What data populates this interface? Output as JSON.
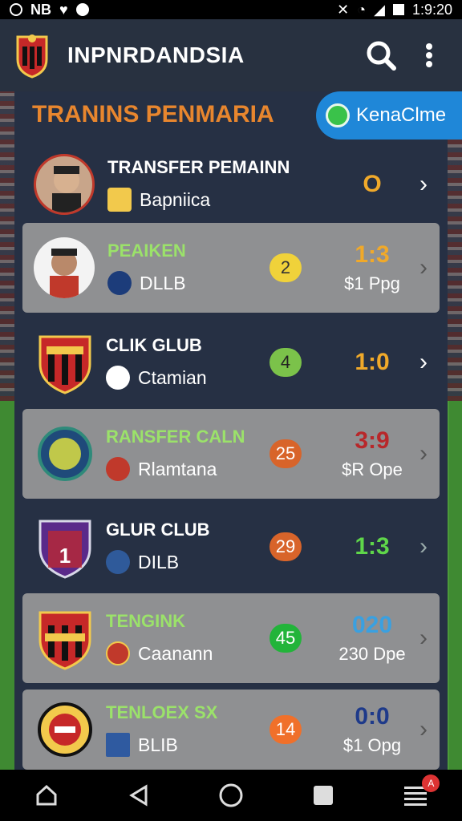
{
  "status": {
    "time": "1:9:20",
    "left_text": "NB"
  },
  "app": {
    "title": "INPNRDANDSIA"
  },
  "section": {
    "title": "TRANINS PENMARIA",
    "pill_label": "KenaClme"
  },
  "rows": [
    {
      "name": "TRANSFER PEMAINN",
      "club": "Bapniica",
      "badge": "",
      "score": "O",
      "extra": "",
      "style": "dark",
      "name_color": "white",
      "score_color": "#f0a92a",
      "badge_color": ""
    },
    {
      "name": "PEAIKEN",
      "club": "DLLB",
      "badge": "2",
      "score": "1:3",
      "extra": "$1 Ppg",
      "style": "light",
      "name_color": "green",
      "score_color": "#f0a92a",
      "badge_color": "#f0d23a"
    },
    {
      "name": "CLIK GLUB",
      "club": "Ctamian",
      "badge": "4",
      "score": "1:0",
      "extra": "",
      "style": "dark",
      "name_color": "white",
      "score_color": "#f0a92a",
      "badge_color": "#7bc24a"
    },
    {
      "name": "RANSFER CALN",
      "club": "Rlamtana",
      "badge": "25",
      "score": "3:9",
      "extra": "$R Ope",
      "style": "light",
      "name_color": "green",
      "score_color": "#b8272a",
      "badge_color": "#d8642a"
    },
    {
      "name": "GLUR CLUB",
      "club": "DILB",
      "badge": "29",
      "score": "1:3",
      "extra": "",
      "style": "dark",
      "name_color": "white",
      "score_color": "#5fd64a",
      "badge_color": "#d8642a"
    },
    {
      "name": "TENGINK",
      "club": "Caanann",
      "badge": "45",
      "score": "020",
      "extra": "230 Dpe",
      "style": "light",
      "name_color": "green",
      "score_color": "#3aa0e0",
      "badge_color": "#22b43a"
    },
    {
      "name": "TENLOEX SX",
      "club": "BLIB",
      "badge": "14",
      "score": "0:0",
      "extra": "$1 Opg",
      "style": "light",
      "name_color": "green",
      "score_color": "#1e3a8a",
      "badge_color": "#f0702a"
    }
  ],
  "nav": {
    "notification_count": "A"
  }
}
